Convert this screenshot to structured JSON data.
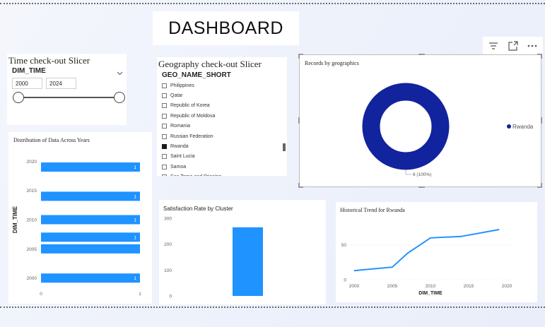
{
  "page_title": "DASHBOARD",
  "toolbar": {
    "icons": [
      "filter-icon",
      "focus-mode-icon",
      "more-options-icon"
    ]
  },
  "time_slicer": {
    "heading": "Time check-out Slicer",
    "field": "DIM_TIME",
    "from": "2000",
    "to": "2024"
  },
  "geo_slicer": {
    "heading": "Geography check-out Slicer",
    "field": "GEO_NAME_SHORT",
    "items": [
      {
        "label": "Philippines",
        "checked": false
      },
      {
        "label": "Qatar",
        "checked": false
      },
      {
        "label": "Republic of Korea",
        "checked": false
      },
      {
        "label": "Republic of Moldova",
        "checked": false
      },
      {
        "label": "Romania",
        "checked": false
      },
      {
        "label": "Russian Federation",
        "checked": false
      },
      {
        "label": "Rwanda",
        "checked": true
      },
      {
        "label": "Saint Lucia",
        "checked": false
      },
      {
        "label": "Samoa",
        "checked": false
      },
      {
        "label": "Sao Tome and Principe",
        "checked": false
      }
    ]
  },
  "colors": {
    "primary": "#1f93ff",
    "donut": "#12239e"
  },
  "chart_data": [
    {
      "id": "records",
      "type": "pie",
      "title": "Records by geographics",
      "categories": [
        "Rwanda"
      ],
      "values": [
        6
      ],
      "data_label": "6 (100%)",
      "legend": [
        "Rwanda"
      ],
      "legend_position": "right"
    },
    {
      "id": "distribution",
      "type": "bar",
      "orientation": "horizontal",
      "title": "Distribution of Data Across Years",
      "ylabel": "DIM_TIME",
      "y_ticks": [
        "2020",
        "2015",
        "2010",
        "2005",
        "2000"
      ],
      "x_ticks": [
        "0",
        "1"
      ],
      "ylim": [
        1999,
        2021
      ],
      "xlim": [
        0,
        1
      ],
      "bars": [
        {
          "year": 2019,
          "value": 1,
          "label": "1"
        },
        {
          "year": 2014,
          "value": 1,
          "label": "1"
        },
        {
          "year": 2010,
          "value": 1,
          "label": "1"
        },
        {
          "year": 2007,
          "value": 1,
          "label": "1"
        },
        {
          "year": 2005,
          "value": 1,
          "label": ""
        },
        {
          "year": 2000,
          "value": 1,
          "label": "1"
        }
      ]
    },
    {
      "id": "satisfaction",
      "type": "bar",
      "title": "Satisfaction Rate by Cluster",
      "y_ticks": [
        "300",
        "200",
        "100",
        "0"
      ],
      "ylim": [
        0,
        300
      ],
      "values": [
        265
      ]
    },
    {
      "id": "trend",
      "type": "line",
      "title": "Historical Trend for Rwanda",
      "xlabel": "DIM_TIME",
      "x_ticks": [
        "2000",
        "2005",
        "2010",
        "2015",
        "2020"
      ],
      "y_ticks": [
        "50",
        "0"
      ],
      "xlim": [
        2000,
        2020
      ],
      "ylim": [
        0,
        75
      ],
      "x": [
        2000,
        2005,
        2007,
        2010,
        2014,
        2019
      ],
      "y": [
        13,
        18,
        38,
        60,
        62,
        72
      ]
    }
  ]
}
